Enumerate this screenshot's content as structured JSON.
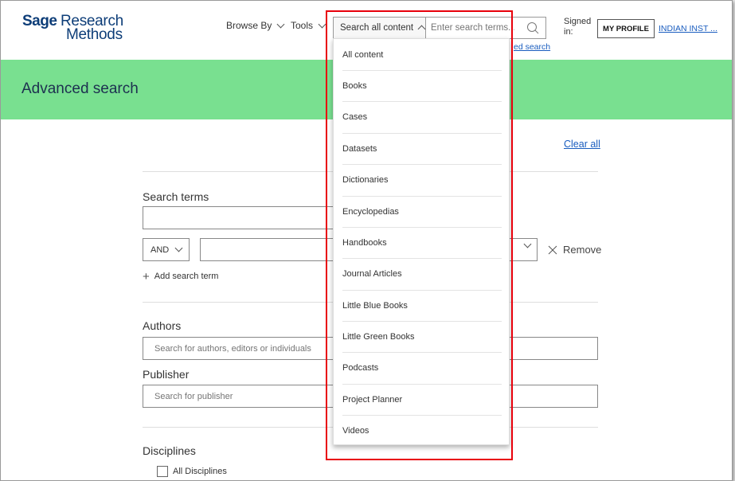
{
  "header": {
    "logo_sage": "Sage",
    "logo_research": "Research",
    "logo_methods": "Methods",
    "nav": {
      "browse_by": "Browse By",
      "tools": "Tools"
    },
    "search": {
      "scope_label": "Search all content",
      "placeholder": "Enter search terms...",
      "advanced_link": "ed search"
    },
    "signed_in": "Signed in:",
    "my_profile": "MY PROFILE",
    "institution": "INDIAN INST ..."
  },
  "banner": {
    "title": "Advanced search"
  },
  "form": {
    "clear_all": "Clear all",
    "search_terms_label": "Search terms",
    "operator": "AND",
    "remove_label": "Remove",
    "add_search_term": "Add search term",
    "authors_label": "Authors",
    "authors_placeholder": "Search for authors, editors or individuals",
    "publisher_label": "Publisher",
    "publisher_placeholder": "Search for publisher",
    "disciplines_label": "Disciplines",
    "all_disciplines": "All Disciplines"
  },
  "dropdown": {
    "items": [
      "All content",
      "Books",
      "Cases",
      "Datasets",
      "Dictionaries",
      "Encyclopedias",
      "Handbooks",
      "Journal Articles",
      "Little Blue Books",
      "Little Green Books",
      "Podcasts",
      "Project Planner",
      "Videos"
    ]
  },
  "colors": {
    "banner": "#79e090",
    "brand_blue": "#0d3d78",
    "link": "#1a5dbf",
    "highlight": "#e8000b"
  }
}
